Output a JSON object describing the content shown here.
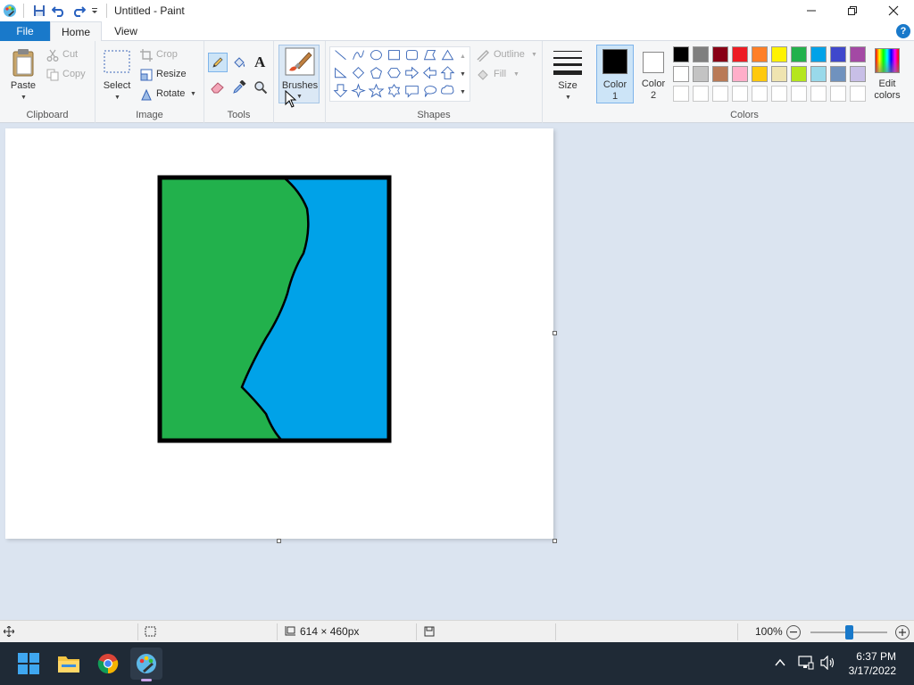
{
  "window": {
    "title": "Untitled - Paint"
  },
  "tabs": {
    "file": "File",
    "home": "Home",
    "view": "View",
    "help": "?"
  },
  "ribbon": {
    "clipboard": {
      "label": "Clipboard",
      "paste": "Paste",
      "cut": "Cut",
      "copy": "Copy"
    },
    "image": {
      "label": "Image",
      "select": "Select",
      "crop": "Crop",
      "resize": "Resize",
      "rotate": "Rotate"
    },
    "tools": {
      "label": "Tools"
    },
    "brushes": {
      "label": "Brushes"
    },
    "shapes": {
      "label": "Shapes",
      "outline": "Outline",
      "fill": "Fill"
    },
    "size": {
      "label": "Size"
    },
    "colors": {
      "label": "Colors",
      "color1_a": "Color",
      "color1_b": "1",
      "color2_a": "Color",
      "color2_b": "2",
      "edit_a": "Edit",
      "edit_b": "colors",
      "color1_value": "#000000",
      "color2_value": "#ffffff",
      "palette_row1": [
        "#000000",
        "#7f7f7f",
        "#880015",
        "#ed1c24",
        "#ff7f27",
        "#fff200",
        "#22b14c",
        "#00a2e8",
        "#3f48cc",
        "#a349a4"
      ],
      "palette_row2": [
        "#ffffff",
        "#c3c3c3",
        "#b97a57",
        "#ffaec9",
        "#ffc90e",
        "#efe4b0",
        "#b5e61d",
        "#99d9ea",
        "#7092be",
        "#c8bfe7"
      ]
    }
  },
  "drawing": {
    "green": "#22b14c",
    "blue": "#00a2e8",
    "border": "#000000"
  },
  "status": {
    "dimensions": "614 × 460px",
    "zoom": "100%",
    "zoom_fraction": 0.5
  },
  "taskbar": {
    "time": "6:37 PM",
    "date": "3/17/2022"
  }
}
